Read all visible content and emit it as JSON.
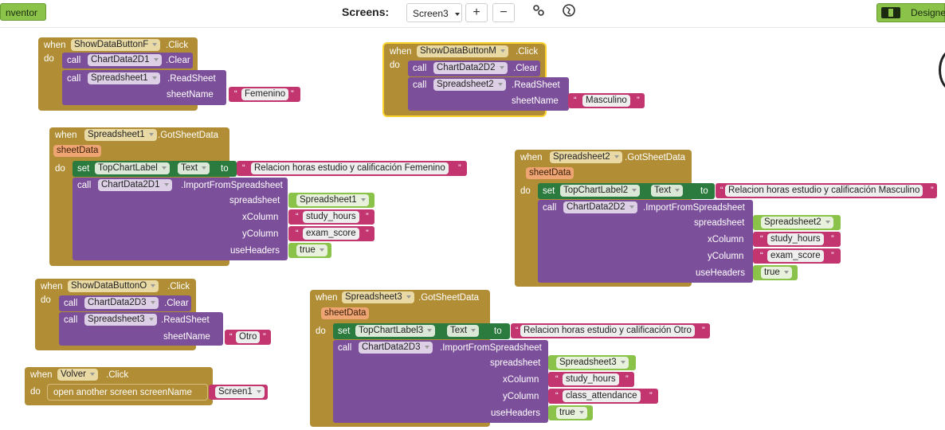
{
  "topbar": {
    "inventor_label": "nventor",
    "screens_label": "Screens:",
    "screen_select": "Screen3",
    "add_symbol": "+",
    "remove_symbol": "−",
    "designer_label": "Designe",
    "icons": [
      "settings-icon",
      "globe-icon",
      "layout-icon"
    ]
  },
  "kw": {
    "when": "when",
    "do": "do",
    "call": "call",
    "set": "set",
    "to": "to",
    "click": ".Click",
    "clear": ".Clear",
    "readsheet": ".ReadSheet",
    "gotsheetdata": ".GotSheetData",
    "importfrom": ".ImportFromSpreadsheet",
    "sheetName": "sheetName",
    "spreadsheet": "spreadsheet",
    "xColumn": "xColumn",
    "yColumn": "yColumn",
    "useHeaders": "useHeaders",
    "sheetData": "sheetData",
    "open_screen": "open another screen  screenName",
    "text_prop": "Text",
    "true": "true"
  },
  "blocks": {
    "b1": {
      "button": "ShowDataButtonF",
      "chart": "ChartData2D1",
      "spreadsheet": "Spreadsheet1",
      "sheet": "Femenino"
    },
    "b2": {
      "button": "ShowDataButtonM",
      "chart": "ChartData2D2",
      "spreadsheet": "Spreadsheet2",
      "sheet": "Masculino"
    },
    "b3": {
      "spreadsheet": "Spreadsheet1",
      "label": "TopChartLabel",
      "title": "Relacion horas estudio y calificación Femenino",
      "chart": "ChartData2D1",
      "ss_val": "Spreadsheet1",
      "x": "study_hours",
      "y": "exam_score",
      "headers": "true"
    },
    "b4": {
      "spreadsheet": "Spreadsheet2",
      "label": "TopChartLabel2",
      "title": "Relacion horas estudio y calificación Masculino",
      "chart": "ChartData2D2",
      "ss_val": "Spreadsheet2",
      "x": "study_hours",
      "y": "exam_score",
      "headers": "true"
    },
    "b5": {
      "button": "ShowDataButtonO",
      "chart": "ChartData2D3",
      "spreadsheet": "Spreadsheet3",
      "sheet": "Otro"
    },
    "b6": {
      "spreadsheet": "Spreadsheet3",
      "label": "TopChartLabel3",
      "title": "Relacion horas estudio y calificación Otro",
      "chart": "ChartData2D3",
      "ss_val": "Spreadsheet3",
      "x": "study_hours",
      "y": "class_attendance",
      "headers": "true"
    },
    "b7": {
      "button": "Volver",
      "screen": "Screen1"
    }
  },
  "colors": {
    "event": "#b18e35",
    "procedure": "#7c4f9a",
    "text": "#c3356f",
    "setter": "#2b7a3e",
    "logic": "#8bc34a",
    "select": "#fcd32e"
  }
}
